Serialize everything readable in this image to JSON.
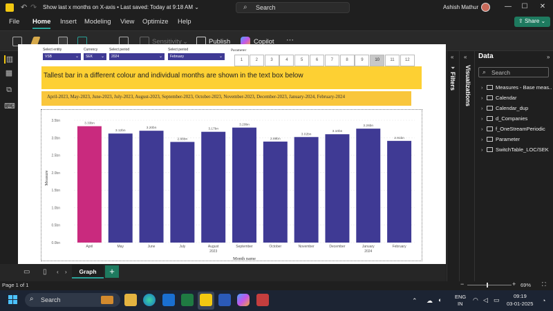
{
  "window": {
    "title": "Show last x months on X-axis • Last saved: Today at 9:18 AM",
    "title_chevron": "⌄",
    "search_placeholder": "Search",
    "user": "Ashish Mathur"
  },
  "menu": [
    "File",
    "Home",
    "Insert",
    "Modeling",
    "View",
    "Optimize",
    "Help"
  ],
  "share_label": "Share",
  "ribbon": {
    "sensitivity": "Sensitivity",
    "publish": "Publish",
    "copilot": "Copilot",
    "more": "···"
  },
  "slicers": [
    {
      "title": "Select entity",
      "value": "VSB"
    },
    {
      "title": "Currency",
      "value": "SEK"
    },
    {
      "title": "Select period",
      "value": "2024"
    },
    {
      "title": "Select period",
      "value": "February"
    }
  ],
  "parameter": {
    "title": "Parameter",
    "options": [
      "1",
      "2",
      "3",
      "4",
      "5",
      "6",
      "7",
      "8",
      "9",
      "10",
      "11",
      "12"
    ],
    "selected": "10"
  },
  "banner_text": "Tallest bar in a different colour and individual months are shown in the text box below",
  "months_text": "April-2023, May-2023, June-2023, July-2023, August-2023, September-2023, October-2023, November-2023, December-2023, January-2024, February-2024",
  "chart_data": {
    "type": "bar",
    "categories": [
      "April",
      "May",
      "June",
      "July",
      "August",
      "September",
      "October",
      "November",
      "December",
      "January",
      "February"
    ],
    "year_labels": [
      {
        "under": "August",
        "text": "2023"
      },
      {
        "under": "January",
        "text": "2024"
      }
    ],
    "values": [
      3.33,
      3.12,
      3.2,
      2.88,
      3.17,
      3.29,
      2.89,
      3.02,
      3.1,
      3.26,
      2.91
    ],
    "data_labels": [
      "3.33bn",
      "3.12bn",
      "3.20bn",
      "2.88bn",
      "3.17bn",
      "3.29bn",
      "2.89bn",
      "3.02bn",
      "3.10bn",
      "3.26bn",
      "2.91bn"
    ],
    "yticks": [
      "0.0bn",
      "0.5bn",
      "1.0bn",
      "1.5bn",
      "2.0bn",
      "2.5bn",
      "3.0bn",
      "3.5bn"
    ],
    "ylim": [
      0,
      3.5
    ],
    "xlabel": "Month name",
    "ylabel": "Measure",
    "highlight_color": "#c92a7e",
    "bar_color": "#3f3a94",
    "grid": true
  },
  "panes": {
    "visualizations": "Visualizations",
    "filters": "Filters",
    "data_title": "Data",
    "data_search": "Search",
    "data_items": [
      "Measures - Base meas...",
      "Calendar",
      "Calendar_dup",
      "d_Companies",
      "f_OneStreamPeriodic",
      "Parameter",
      "SwitchTable_LOC/SEK"
    ]
  },
  "page_tab": "Graph",
  "status": {
    "page": "Page 1 of 1",
    "zoom": "69%"
  },
  "taskbar": {
    "search": "Search",
    "lang_line1": "ENG",
    "lang_line2": "IN",
    "time": "09:19",
    "date": "03-01-2025"
  }
}
